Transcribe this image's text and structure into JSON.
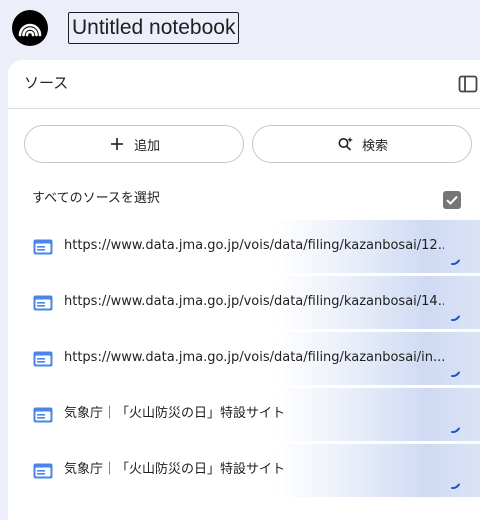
{
  "header": {
    "notebook_title": "Untitled notebook"
  },
  "sources_panel": {
    "title": "ソース",
    "add_label": "追加",
    "search_label": "検索",
    "select_all_label": "すべてのソースを選択",
    "select_all_checked": true,
    "items": [
      {
        "label": "https://www.data.jma.go.jp/vois/data/filing/kazanbosai/12..."
      },
      {
        "label": "https://www.data.jma.go.jp/vois/data/filing/kazanbosai/14..."
      },
      {
        "label": "https://www.data.jma.go.jp/vois/data/filing/kazanbosai/in..."
      },
      {
        "label": "気象庁｜「火山防災の日」特設サイト"
      },
      {
        "label": "気象庁｜「火山防災の日」特設サイト"
      }
    ]
  },
  "colors": {
    "page_bg": "#eceff9",
    "panel_bg": "#ffffff",
    "doc_icon": "#4a86e8",
    "checkbox": "#747775"
  }
}
